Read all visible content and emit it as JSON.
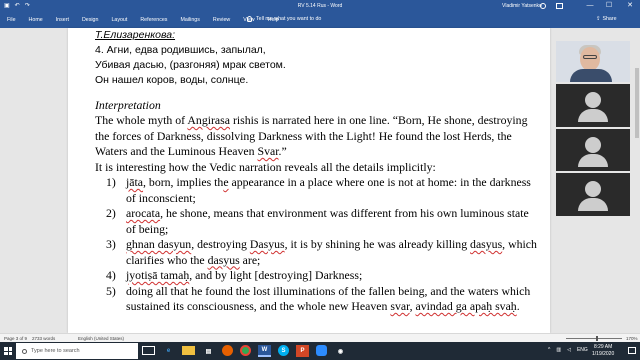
{
  "window": {
    "title": "RV 5.14 Rus  -  Word",
    "user": "Vladimir Yatsenko",
    "colors": {
      "ribbon": "#2b579a",
      "spellcheck": "#d03030",
      "taskbar": "#1f2a36"
    }
  },
  "titlebar": {
    "quick_access": [
      "save-icon",
      "undo-icon",
      "redo-icon"
    ],
    "min_label": "—",
    "max_label": "☐",
    "close_label": "✕"
  },
  "ribbon": {
    "tabs": [
      "File",
      "Home",
      "Insert",
      "Design",
      "Layout",
      "References",
      "Mailings",
      "Review",
      "View",
      "Help"
    ],
    "tell_me": "Tell me what you want to do",
    "share_label": "Share"
  },
  "document": {
    "ru_title": "Т.Елизаренкова:",
    "ru_lines": [
      "4. Агни, едва родившись, запылал,",
      "Убивая дасью, (разгоняя) мрак светом.",
      "Он нашел коров, воды, солнце."
    ],
    "heading": "Interpretation",
    "para1": {
      "a": "The whole myth of ",
      "b": "Angirasa",
      "c": " rishis is narrated here in one line. “Born, He shone, destroying the forces of Darkness, dissolving Darkness with the Light! He found the lost Herds, the Waters and the Luminous Heaven ",
      "d": "Svar",
      "e": ".”"
    },
    "para2": "It is interesting how the Vedic narration reveals all the details implicitly:",
    "items": [
      {
        "num": "1)",
        "a": "jāta",
        "b": ", born, implies th",
        "c": "e",
        "d": " appearance in a place where one is not at home: in the darkness of inconscient;"
      },
      {
        "num": "2)",
        "a": "arocata",
        "b": ", he shone, means that environment was different from his own luminous state of being;"
      },
      {
        "num": "3)",
        "a": "ghnan dasyun",
        "b": ",  destroying ",
        "c": "Dasyus",
        "d": ", it is by shining he was already killing ",
        "e": "dasyus",
        "f": ", which clarifies who the ",
        "g": "dasyus",
        "h": " are;"
      },
      {
        "num": "4)",
        "a": "jyotiṣā tamaḥ",
        "b": ", and by light [destroying] Darkness;"
      },
      {
        "num": "5)",
        "a": "doing all that he found the lost illuminations of the fallen being, and the waters which sustained its consciousness, and the whole new Heaven ",
        "b": "svar",
        "c": ", ",
        "d": "avindad ga apaḥ svaḥ",
        "e": "."
      }
    ]
  },
  "status": {
    "page": "Page 3 of 9",
    "words": "2733 words",
    "language": "English (United States)",
    "zoom": "170%"
  },
  "taskbar": {
    "search_placeholder": "Type here to search",
    "apps": [
      "task-view-icon",
      "edge-icon",
      "file-explorer-icon",
      "store-icon",
      "firefox-icon",
      "chrome-icon",
      "word-icon",
      "skype-icon",
      "powerpoint-icon",
      "zoom-icon",
      "camera-icon"
    ],
    "tray_lang": "ENG",
    "time": "8:29 AM",
    "date": "1/19/2020"
  }
}
